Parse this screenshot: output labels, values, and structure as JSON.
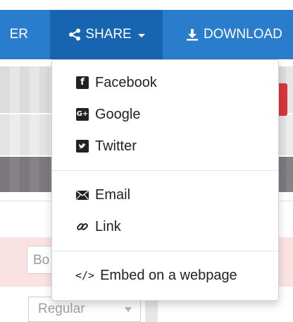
{
  "navbar": {
    "left_fragment": "ER",
    "share_label": "SHARE",
    "download_label": "DOWNLOAD"
  },
  "background": {
    "input_fragment": "Bo",
    "select_value": "Regular"
  },
  "share_menu": {
    "social": [
      {
        "label": "Facebook",
        "icon": "facebook-icon"
      },
      {
        "label": "Google",
        "icon": "google-icon"
      },
      {
        "label": "Twitter",
        "icon": "twitter-icon"
      }
    ],
    "direct": [
      {
        "label": "Email",
        "icon": "envelope-icon"
      },
      {
        "label": "Link",
        "icon": "link-icon"
      }
    ],
    "embed": {
      "label": "Embed on a webpage",
      "icon": "code-icon"
    }
  },
  "colors": {
    "navbar": "#2a7ccc",
    "share_active": "#1764b0",
    "alert_red": "#d9363e",
    "pink_row": "#fbe2e2"
  }
}
